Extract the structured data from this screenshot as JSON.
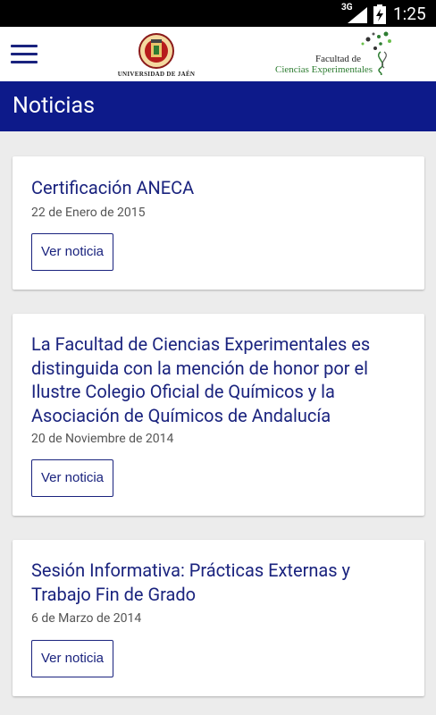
{
  "status_bar": {
    "network": "3G",
    "time": "1:25"
  },
  "header": {
    "logo_left_text": "UNIVERSIDAD DE JAÉN",
    "logo_right_line1": "Facultad de",
    "logo_right_line2": "Ciencias Experimentales"
  },
  "page": {
    "title": "Noticias"
  },
  "news": [
    {
      "title": "Certificación ANECA",
      "date": "22 de Enero de 2015",
      "button": "Ver noticia"
    },
    {
      "title": "La Facultad de Ciencias Experimentales es distinguida con la mención de honor por el Ilustre Colegio Oficial de Químicos y la Asociación de Químicos de Andalucía",
      "date": "20 de Noviembre de 2014",
      "button": "Ver noticia"
    },
    {
      "title": "Sesión Informativa: Prácticas Externas y Trabajo Fin de Grado",
      "date": "6 de Marzo de 2014",
      "button": "Ver noticia"
    }
  ],
  "colors": {
    "primary": "#0d1a8a",
    "accent_text": "#1a237e",
    "background": "#ececec"
  }
}
